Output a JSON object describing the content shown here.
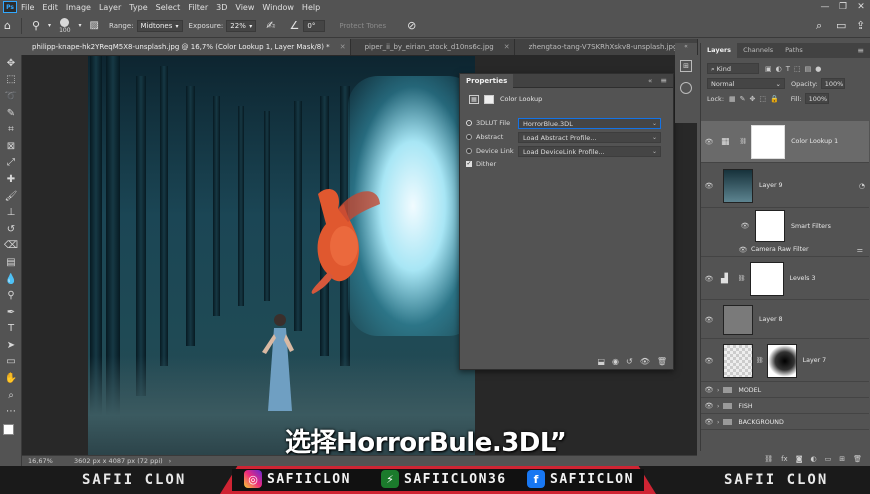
{
  "menu": {
    "items": [
      "File",
      "Edit",
      "Image",
      "Layer",
      "Type",
      "Select",
      "Filter",
      "3D",
      "View",
      "Window",
      "Help"
    ]
  },
  "options_bar": {
    "brush_size": "100",
    "range_label": "Range:",
    "range_value": "Midtones",
    "exposure_label": "Exposure:",
    "exposure_value": "22%",
    "angle_value": "0°",
    "protect_tones": "Protect Tones"
  },
  "tabs": [
    {
      "label": "philipp-knape-hk2YReqM5X8-unsplash.jpg @ 16,7% (Color Lookup 1, Layer Mask/8) *",
      "active": true
    },
    {
      "label": "piper_ii_by_eirian_stock_d10ns6c.jpg",
      "active": false
    },
    {
      "label": "zhengtao-tang-V7SKRhXskv8-unsplash.jpg",
      "active": false
    }
  ],
  "status_bar": {
    "zoom": "16,67%",
    "doc_info": "3602 px x 4087 px (72 ppi)"
  },
  "subtitle": "选择HorrorBule.3DL”",
  "properties": {
    "title": "Properties",
    "adjustment_name": "Color Lookup",
    "rows": [
      {
        "label": "3DLUT File",
        "value": "HorrorBlue.3DL",
        "selected": true
      },
      {
        "label": "Abstract",
        "value": "Load Abstract Profile...",
        "selected": false
      },
      {
        "label": "Device Link",
        "value": "Load DeviceLink Profile...",
        "selected": false
      }
    ],
    "dither_label": "Dither"
  },
  "layers_panel": {
    "tabs": [
      "Layers",
      "Channels",
      "Paths"
    ],
    "filter_kind": "Kind",
    "blend_mode": "Normal",
    "opacity_label": "Opacity:",
    "opacity_value": "100%",
    "lock_label": "Lock:",
    "fill_label": "Fill:",
    "fill_value": "100%",
    "layers": [
      {
        "name": "Color Lookup 1"
      },
      {
        "name": "Layer 9"
      },
      {
        "name": "Smart Filters"
      },
      {
        "name": "Camera Raw Filter"
      },
      {
        "name": "Levels 3"
      },
      {
        "name": "Layer 8"
      },
      {
        "name": "Layer 7"
      }
    ],
    "groups": [
      "MODEL",
      "FISH",
      "BACKGROUND"
    ]
  },
  "banner": {
    "left_name": "SAFII CLON",
    "instagram": "SAFIICLON",
    "other": "SAFIICLON36",
    "facebook": "SAFIICLON",
    "right_name": "SAFII CLON",
    "colors": {
      "red": "#cf2433"
    }
  }
}
